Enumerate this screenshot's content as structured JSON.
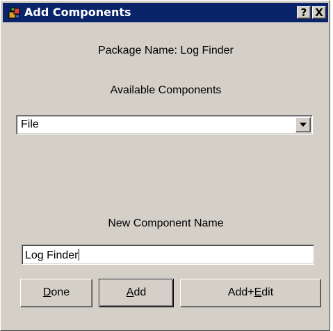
{
  "window": {
    "title": "Add Components",
    "help_label": "?",
    "close_label": "X"
  },
  "package": {
    "label": "Package Name: Log Finder"
  },
  "components": {
    "label": "Available Components",
    "selected": "File"
  },
  "new_name": {
    "label": "New Component Name",
    "value": "Log Finder"
  },
  "buttons": {
    "done": {
      "prefix": "",
      "mnemonic": "D",
      "suffix": "one"
    },
    "add": {
      "prefix": "",
      "mnemonic": "A",
      "suffix": "dd"
    },
    "add_edit": {
      "prefix": "Add+",
      "mnemonic": "E",
      "suffix": "dit"
    }
  },
  "colors": {
    "titlebar": "#0a246a",
    "face": "#d4d0c8"
  }
}
